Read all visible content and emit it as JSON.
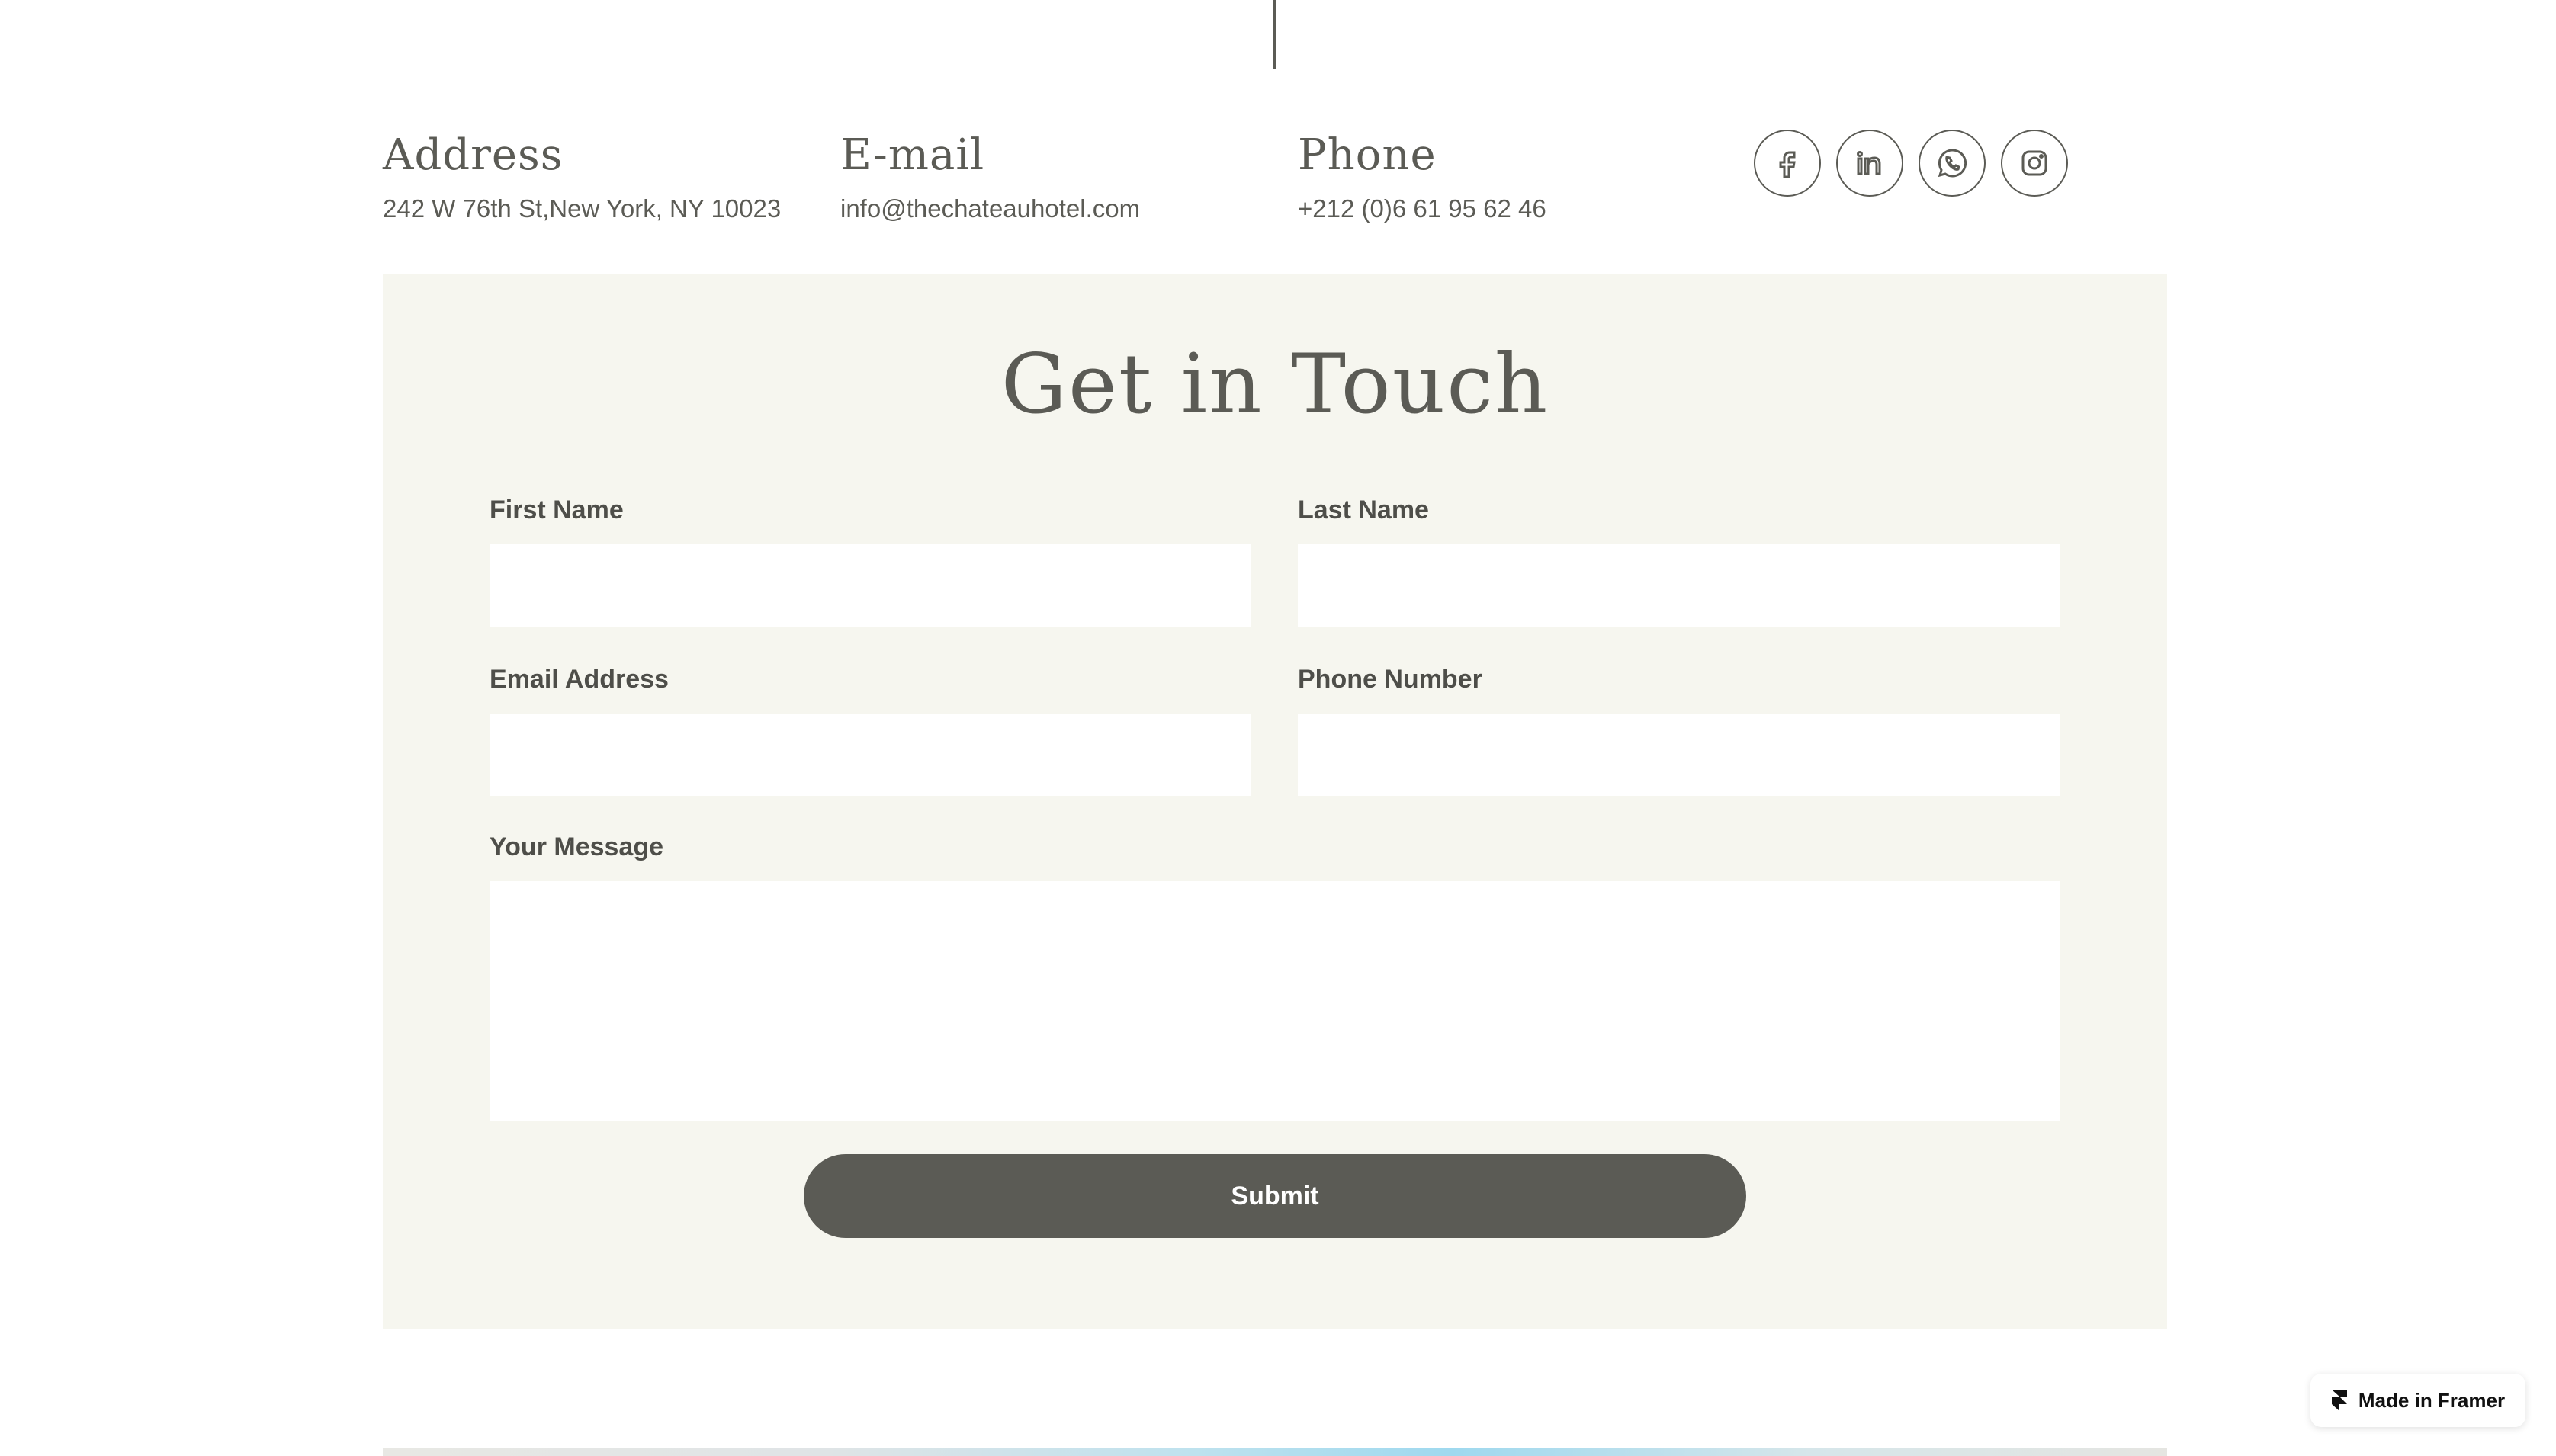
{
  "contact": {
    "address": {
      "heading": "Address",
      "value": "242 W 76th St,New York, NY 10023"
    },
    "email": {
      "heading": "E-mail",
      "value": "info@thechateauhotel.com"
    },
    "phone": {
      "heading": "Phone",
      "value": "+212 (0)6 61 95 62 46"
    }
  },
  "socials": [
    "facebook-icon",
    "linkedin-icon",
    "whatsapp-icon",
    "instagram-icon"
  ],
  "form": {
    "title": "Get in Touch",
    "first_name_label": "First Name",
    "last_name_label": "Last Name",
    "email_label": "Email Address",
    "phone_label": "Phone Number",
    "message_label": "Your Message",
    "submit_label": "Submit"
  },
  "badge": {
    "label": "Made in Framer"
  },
  "colors": {
    "text": "#5b5b55",
    "panel": "#f6f6ef",
    "button": "#5b5b55"
  }
}
